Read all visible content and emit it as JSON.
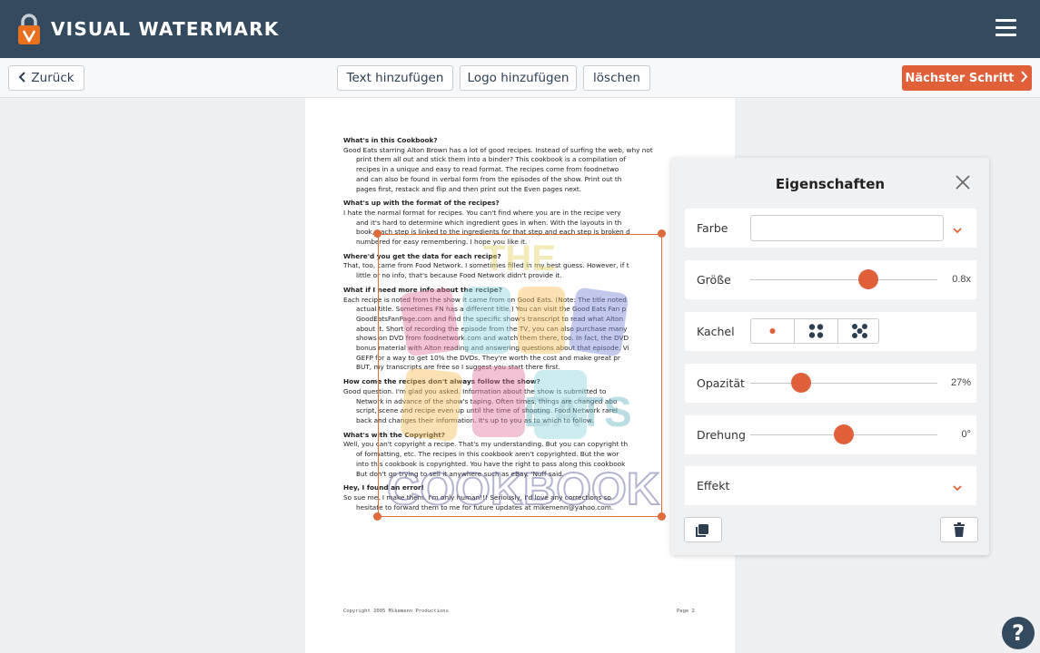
{
  "header": {
    "app_name": "VISUAL WATERMARK",
    "menu_icon": "hamburger-icon"
  },
  "toolbar": {
    "back_label": "Zurück",
    "add_text_label": "Text hinzufügen",
    "add_logo_label": "Logo hinzufügen",
    "delete_label": "löschen",
    "next_label": "Nächster Schritt",
    "accent_color": "#e0603a"
  },
  "document": {
    "sections": [
      {
        "heading": "What's in this Cookbook?",
        "lines": [
          "Good Eats starring Alton Brown has a lot of good recipes. Instead of surfing the web, why not",
          "print them all out and stick them into a binder? This cookbook is a compilation of",
          "recipes in a unique and easy to read format. The recipes come from foodnetwo",
          "and can also be found in verbal form from the episodes of the show. Print out th",
          "pages first, restack and flip and then print out the Even pages next."
        ]
      },
      {
        "heading": "What's up with the format of the recipes?",
        "lines": [
          "I hate the normal format for recipes. You can't find where you are in the recipe very",
          "and it's hard to determine which ingredient goes in when. With the layouts in th",
          "book, each step is linked to the ingredients for that step and each step is broken d",
          "numbered for easy remembering. I hope you like it."
        ]
      },
      {
        "heading": "Where'd you get the data for each recipe?",
        "lines": [
          "That, too, came from Food Network. I sometimes filled in my best guess. However, if t",
          "little or no info, that's because Food Network didn't provide it."
        ]
      },
      {
        "heading": "What if I need more info about the recipe?",
        "lines": [
          "Each recipe is noted from the show it came from on Good Eats. (Note: The title noted",
          "actual title. Sometimes FN has a different title.) You can visit the Good Eats Fan p",
          "GoodEatsFanPage.com and find the specific show's transcript to read what Alton",
          "about it. Short of recording the episode from the TV, you can also purchase many",
          "shows on DVD from foodnetwork.com and watch them there, too. In fact, the DVD",
          "bonus material with Alton reading and answering questions about that episode. Vi",
          "GEFP for a way to get 10% the DVDs. They're worth the cost and make great pr",
          "BUT, my transcripts are free so I suggest you start there first."
        ]
      },
      {
        "heading": "How come the recipes don't always follow the show?",
        "lines": [
          "Good question. I'm glad you asked. Information about the show is submitted to",
          "Network in advance of the show's taping. Often times, things are changed abo",
          "script, scene and recipe even up until the time of shooting. Food Network rarel",
          "back and changes their information. It's up to you as to which to follow."
        ]
      },
      {
        "heading": "What's with the Copyright?",
        "lines": [
          "Well, you can't copyright a recipe. That's my understanding. But you can copyright th",
          "of formatting, etc. The recipes in this cookbook aren't copyrighted. But the wor",
          "into this cookbook is copyrighted. You have the right to pass along this cookbook",
          "But don't go trying to sell it anywhere such as eBay. 'Nuff said."
        ]
      },
      {
        "heading": "Hey, I found an error!",
        "lines": [
          "So sue me. I make them. I'm only human!!! Seriously, I'd love any corrections so",
          "hesitate to forward them to me for future updates at mikemenn@yahoo.com."
        ]
      }
    ],
    "footer_left": "Copyright 2005 Mikemenn Productions",
    "footer_right": "Page 2"
  },
  "watermark": {
    "line1": "THE",
    "line3": "EATS",
    "line4": "COOKBOOK"
  },
  "panel": {
    "title": "Eigenschaften",
    "color_label": "Farbe",
    "color_value": "",
    "size_label": "Größe",
    "size_value": "0.8x",
    "size_fraction": 0.63,
    "tile_label": "Kachel",
    "tile_options": [
      "single-dot-icon",
      "four-dots-icon",
      "five-dots-icon"
    ],
    "opacity_label": "Opazität",
    "opacity_value": "27%",
    "opacity_fraction": 0.27,
    "rotation_label": "Drehung",
    "rotation_value": "0°",
    "rotation_fraction": 0.5,
    "effect_label": "Effekt"
  },
  "help": {
    "label": "?"
  }
}
